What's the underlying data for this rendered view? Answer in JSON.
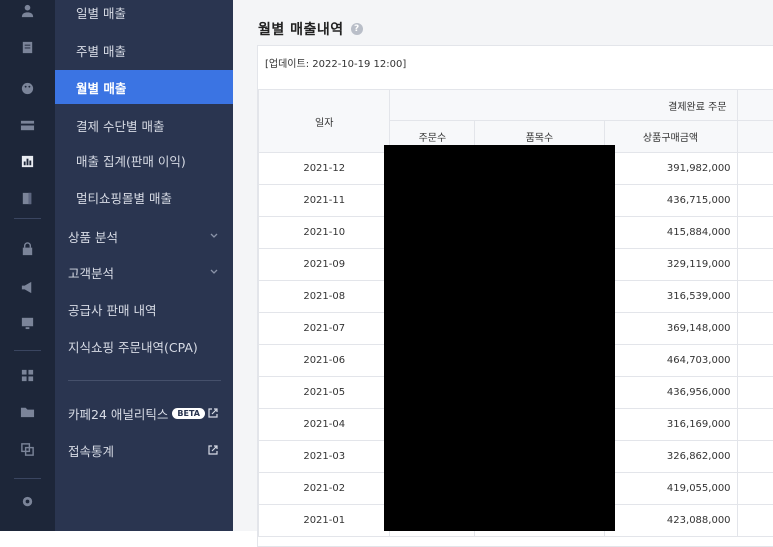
{
  "sidebar": {
    "items": [
      {
        "label": "일별 매출"
      },
      {
        "label": "주별 매출"
      },
      {
        "label": "월별 매출"
      },
      {
        "label": "결제 수단별 매출"
      },
      {
        "label": "매출 집계(판매 이익)"
      },
      {
        "label": "멀티쇼핑몰별 매출"
      },
      {
        "label": "상품 분석"
      },
      {
        "label": "고객분석"
      },
      {
        "label": "공급사 판매 내역"
      },
      {
        "label": "지식쇼핑 주문내역(CPA)"
      },
      {
        "label": "카페24 애널리틱스",
        "badge": "BETA"
      },
      {
        "label": "접속통계"
      }
    ]
  },
  "main": {
    "title": "월별 매출내역",
    "help": "?",
    "updated": "[업데이트: 2022-10-19 12:00]",
    "table": {
      "date_header": "일자",
      "group_header": "결제완료 주문",
      "sub_headers": [
        "주문수",
        "품목수",
        "상품구매금액"
      ],
      "rows": [
        {
          "date": "2021-12",
          "amount": "391,982,000"
        },
        {
          "date": "2021-11",
          "amount": "436,715,000"
        },
        {
          "date": "2021-10",
          "amount": "415,884,000"
        },
        {
          "date": "2021-09",
          "amount": "329,119,000"
        },
        {
          "date": "2021-08",
          "amount": "316,539,000"
        },
        {
          "date": "2021-07",
          "amount": "369,148,000"
        },
        {
          "date": "2021-06",
          "amount": "464,703,000"
        },
        {
          "date": "2021-05",
          "amount": "436,956,000"
        },
        {
          "date": "2021-04",
          "amount": "316,169,000"
        },
        {
          "date": "2021-03",
          "amount": "326,862,000"
        },
        {
          "date": "2021-02",
          "amount": "419,055,000"
        },
        {
          "date": "2021-01",
          "amount": "423,088,000"
        }
      ]
    }
  },
  "colors": {
    "rail": "#1d2639",
    "sidebar": "#2a3550",
    "active": "#3b74e3",
    "redaction": "#000000"
  },
  "icons": [
    "user-icon",
    "document-icon",
    "palette-icon",
    "card-icon",
    "chart-icon",
    "book-icon",
    "bag-icon",
    "megaphone-icon",
    "board-icon",
    "apps-icon",
    "folder-add-icon",
    "copy-icon",
    "gear-icon",
    "chevron-down-icon",
    "external-link-icon"
  ]
}
